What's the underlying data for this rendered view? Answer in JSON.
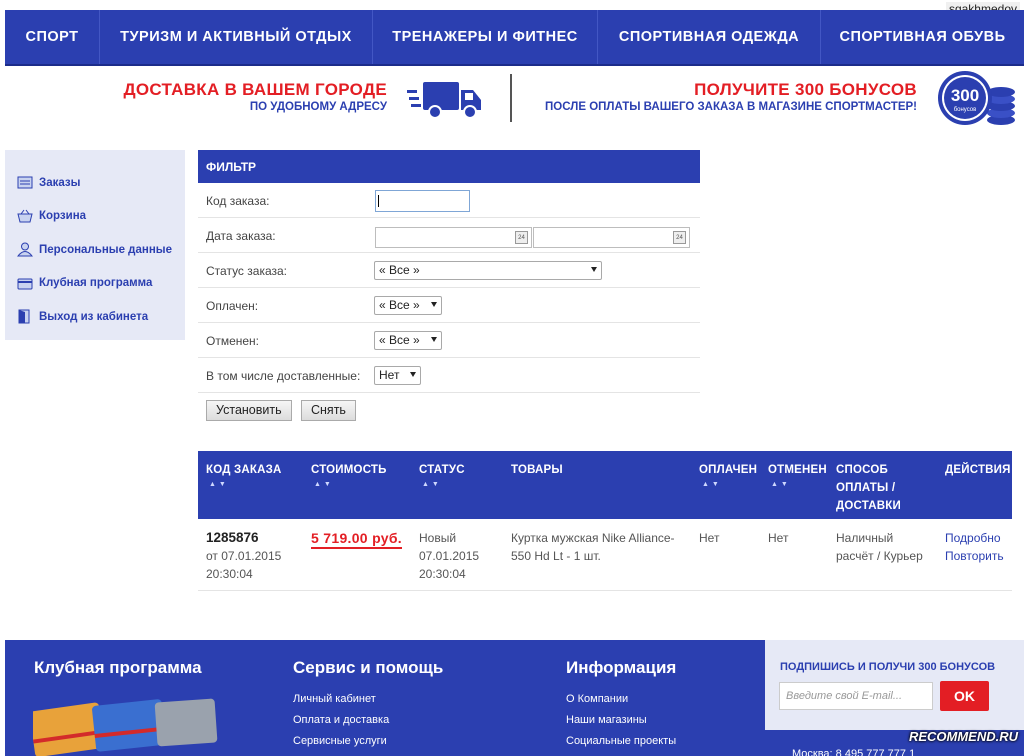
{
  "watermark_user": "sgakhmedov",
  "colors": {
    "brand_blue": "#2b3fb0",
    "accent_red": "#e31e24",
    "sidebar_bg": "#e6e9f6"
  },
  "nav": {
    "items": [
      {
        "label": "СПОРТ"
      },
      {
        "label": "ТУРИЗМ И АКТИВНЫЙ ОТДЫХ"
      },
      {
        "label": "ТРЕНАЖЕРЫ И ФИТНЕС"
      },
      {
        "label": "СПОРТИВНАЯ ОДЕЖДА"
      },
      {
        "label": "СПОРТИВНАЯ ОБУВЬ"
      }
    ]
  },
  "promo": {
    "left_title": "ДОСТАВКА В ВАШЕМ ГОРОДЕ",
    "left_sub": "ПО УДОБНОМУ АДРЕСУ",
    "right_title": "ПОЛУЧИТЕ 300 БОНУСОВ",
    "right_sub": "ПОСЛЕ ОПЛАТЫ ВАШЕГО ЗАКАЗА В МАГАЗИНЕ СПОРТМАСТЕР!",
    "coin_number": "300",
    "coin_word": "бонусов",
    "truck_icon": "delivery-truck-icon"
  },
  "sidebar": {
    "items": [
      {
        "label": "Заказы",
        "icon": "orders-icon"
      },
      {
        "label": "Корзина",
        "icon": "basket-icon"
      },
      {
        "label": "Персональные данные",
        "icon": "user-icon"
      },
      {
        "label": "Клубная программа",
        "icon": "card-icon"
      },
      {
        "label": "Выход из кабинета",
        "icon": "exit-door-icon"
      }
    ]
  },
  "filter": {
    "title": "ФИЛЬТР",
    "order_code_label": "Код заказа:",
    "order_code_value": "",
    "order_date_label": "Дата заказа:",
    "date_from": "",
    "date_to": "",
    "calendar_day": "24",
    "status_label": "Статус заказа:",
    "status_value": "« Все »",
    "paid_label": "Оплачен:",
    "paid_value": "« Все »",
    "cancelled_label": "Отменен:",
    "cancelled_value": "« Все »",
    "delivered_label": "В том числе доставленные:",
    "delivered_value": "Нет",
    "apply_button": "Установить",
    "reset_button": "Снять"
  },
  "orders": {
    "columns": {
      "code": "КОД ЗАКАЗА",
      "cost": "СТОИМОСТЬ",
      "status": "СТАТУС",
      "goods": "ТОВАРЫ",
      "paid": "ОПЛАЧЕН",
      "cancelled": "ОТМЕНЕН",
      "method_l1": "СПОСОБ",
      "method_l2": "ОПЛАТЫ /",
      "method_l3": "ДОСТАВКИ",
      "actions": "ДЕЙСТВИЯ"
    },
    "sort_glyph": "▲▼",
    "rows": [
      {
        "id": "1285876",
        "date": "от 07.01.2015",
        "time": "20:30:04",
        "cost": "5 719.00 руб.",
        "status": "Новый",
        "status_date": "07.01.2015",
        "status_time": "20:30:04",
        "goods_l1": "Куртка мужская Nike Alliance-",
        "goods_l2": "550 Hd Lt - 1 шт.",
        "paid": "Нет",
        "cancelled": "Нет",
        "method_l1": "Наличный",
        "method_l2": "расчёт / Курьер",
        "action_details": "Подробно",
        "action_repeat": "Повторить"
      }
    ]
  },
  "footer": {
    "col1_title": "Клубная программа",
    "col2_title": "Сервис и помощь",
    "col2_links": [
      "Личный кабинет",
      "Оплата и доставка",
      "Сервисные услуги"
    ],
    "col3_title": "Информация",
    "col3_links": [
      "О Компании",
      "Наши магазины",
      "Социальные проекты"
    ],
    "subscribe_title": "ПОДПИШИСЬ И ПОЛУЧИ 300 БОНУСОВ",
    "email_placeholder": "Введите свой E-mail...",
    "ok_button": "OK",
    "phone": "Москва: 8 495 777 777 1"
  },
  "recommend_watermark": "RECOMMEND.RU"
}
